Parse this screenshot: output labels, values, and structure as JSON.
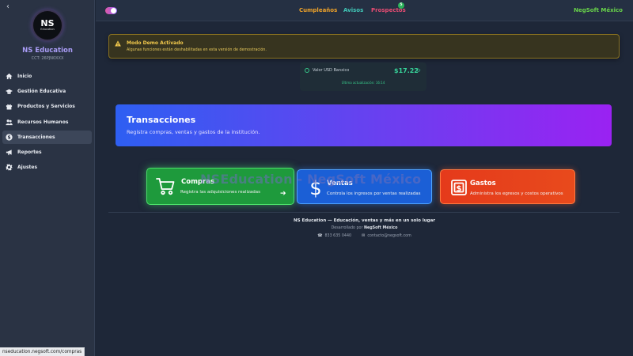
{
  "sidebar": {
    "collapse_icon": "chevron-left-icon",
    "logo": {
      "initials": "NS",
      "subtitle": "Education"
    },
    "brand": "NS Education",
    "cct": "CCT: 26PJN0XXX",
    "items": [
      {
        "label": "Inicio",
        "icon": "home-icon",
        "active": false
      },
      {
        "label": "Gestión Educativa",
        "icon": "graduation-cap-icon",
        "active": false
      },
      {
        "label": "Productos y Servicios",
        "icon": "gift-icon",
        "active": false
      },
      {
        "label": "Recursos Humanos",
        "icon": "users-icon",
        "active": false
      },
      {
        "label": "Transacciones",
        "icon": "dollar-icon",
        "active": true
      },
      {
        "label": "Reportes",
        "icon": "megaphone-icon",
        "active": false
      },
      {
        "label": "Ajustes",
        "icon": "gear-icon",
        "active": false
      }
    ]
  },
  "topbar": {
    "nav": [
      {
        "label": "Cumpleaños",
        "color": "#f0a329"
      },
      {
        "label": "Avisos",
        "color": "#41c8b8"
      },
      {
        "label": "Prospectos",
        "color": "#e84c73",
        "badge": "5"
      }
    ],
    "company": "NegSoft México"
  },
  "demo_banner": {
    "icon": "warning-icon",
    "title": "Modo Demo Activado",
    "description": "Algunas funciones están deshabilitadas en esta versión de demostración."
  },
  "usd": {
    "label": "Valor USD Banxico",
    "value": "$17.22",
    "refresh_icon": "refresh-icon",
    "updated": "Última actualización: 16:14"
  },
  "hero": {
    "title": "Transacciones",
    "subtitle": "Registra compras, ventas y gastos de la institución."
  },
  "watermark": "NSEducation - NegSoft México",
  "cards": [
    {
      "title": "Compras",
      "description": "Registra las adquisiciones realizadas",
      "icon": "cart-icon",
      "arrow": "➔"
    },
    {
      "title": "Ventas",
      "description": "Controla los ingresos por ventas realizadas",
      "icon": "dollar-sign-icon"
    },
    {
      "title": "Gastos",
      "description": "Administra los egresos y costos operativos",
      "icon": "money-bill-icon"
    }
  ],
  "footer": {
    "tagline": "NS Education — Educación, ventas y más en un solo lugar",
    "developed_by": "Desarrollado por",
    "developer": "NegSoft México",
    "phone": "833 635 0440",
    "email": "contacto@negsoft.com"
  },
  "status_bar": {
    "url": "nseducation.negsoft.com/compras"
  }
}
